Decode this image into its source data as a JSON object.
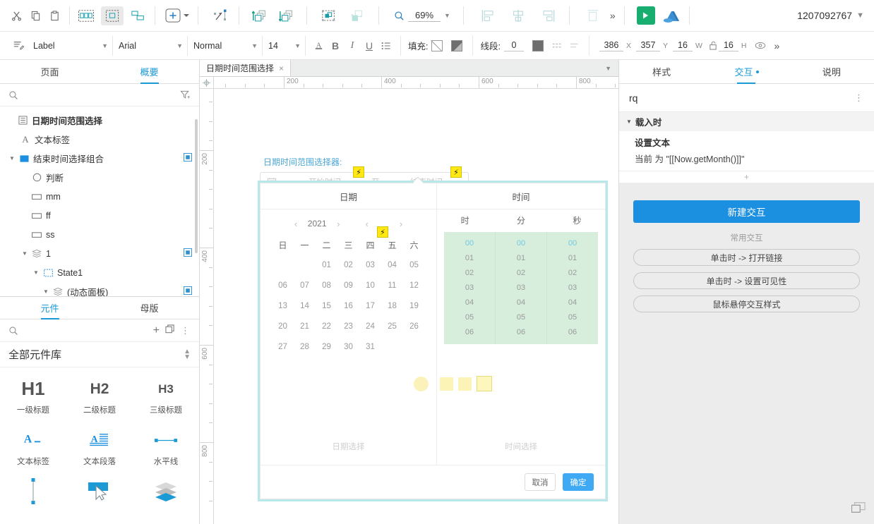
{
  "toolbar_top": {
    "icons": [
      "cut-icon",
      "copy-icon",
      "paste-icon"
    ],
    "group_icons": [
      "group-icon",
      "ungroup-icon",
      "layers-icon"
    ],
    "insert_label": "+",
    "align_icons": [
      "align-left-icon",
      "align-center-icon",
      "align-right-icon"
    ],
    "distribute_icon": "distribute-icon",
    "more_label": "»",
    "zoom_value": "69%",
    "user_id": "1207092767"
  },
  "toolbar_style": {
    "widget_type": "Label",
    "font_family": "Arial",
    "font_weight": "Normal",
    "font_size": "14",
    "fill_label": "填充:",
    "line_label": "线段:",
    "line_width": "0",
    "x_value": "386",
    "x_unit": "X",
    "y_value": "357",
    "y_unit": "Y",
    "w_value": "16",
    "w_unit": "W",
    "h_value": "16",
    "h_unit": "H",
    "format_icons": [
      "font-color-icon",
      "bold-icon",
      "italic-icon",
      "underline-icon",
      "list-icon"
    ],
    "more_label": "»"
  },
  "left_panel": {
    "tabs": [
      {
        "label": "页面",
        "selected": false
      },
      {
        "label": "概要",
        "selected": true
      }
    ],
    "search_placeholder": "",
    "filter_icon": "filter-icon",
    "tree": [
      {
        "label": "日期时间范围选择",
        "indent": 0,
        "icon": "page-icon",
        "arrow": "",
        "bold": true,
        "badge": false
      },
      {
        "label": "文本标签",
        "indent": 1,
        "icon": "text-label-icon",
        "arrow": "",
        "bold": false,
        "badge": false
      },
      {
        "label": "结束时间选择组合",
        "indent": 1,
        "icon": "group-folder-icon",
        "arrow": "▼",
        "bold": false,
        "badge": true
      },
      {
        "label": "判断",
        "indent": 2,
        "icon": "ellipse-icon",
        "arrow": "",
        "bold": false,
        "badge": false
      },
      {
        "label": "mm",
        "indent": 2,
        "icon": "rectangle-icon",
        "arrow": "",
        "bold": false,
        "badge": false
      },
      {
        "label": "ff",
        "indent": 2,
        "icon": "rectangle-icon",
        "arrow": "",
        "bold": false,
        "badge": false
      },
      {
        "label": "ss",
        "indent": 2,
        "icon": "rectangle-icon",
        "arrow": "",
        "bold": false,
        "badge": false
      },
      {
        "label": "1",
        "indent": 2,
        "icon": "dynamic-panel-icon",
        "arrow": "▼",
        "bold": false,
        "badge": true
      },
      {
        "label": "State1",
        "indent": 3,
        "icon": "state-icon",
        "arrow": "▼",
        "bold": false,
        "badge": false
      },
      {
        "label": "(动态面板)",
        "indent": 4,
        "icon": "dynamic-panel-icon",
        "arrow": "▼",
        "bold": false,
        "badge": true
      }
    ],
    "lib_tabs": [
      {
        "label": "元件",
        "selected": true
      },
      {
        "label": "母版",
        "selected": false
      }
    ],
    "lib_add_icon": "plus-icon",
    "lib_copy_icon": "duplicate-icon",
    "lib_more_icon": "kebab-icon",
    "lib_title": "全部元件库",
    "lib_items": [
      {
        "glyph": "H1",
        "label": "一级标题",
        "kind": "h1"
      },
      {
        "glyph": "H2",
        "label": "二级标题",
        "kind": "h2"
      },
      {
        "glyph": "H3",
        "label": "三级标题",
        "kind": "h3"
      },
      {
        "glyph": "A",
        "label": "文本标签",
        "kind": "text-label"
      },
      {
        "glyph": "A",
        "label": "文本段落",
        "kind": "text-paragraph"
      },
      {
        "glyph": "",
        "label": "水平线",
        "kind": "hline"
      },
      {
        "glyph": "",
        "label": "",
        "kind": "vline"
      },
      {
        "glyph": "",
        "label": "",
        "kind": "button"
      },
      {
        "glyph": "",
        "label": "",
        "kind": "panel"
      }
    ]
  },
  "canvas": {
    "page_tab": "日期时间范围选择",
    "page_tab_close": "×",
    "ruler_h_labels": [
      "200",
      "400",
      "600",
      "800"
    ],
    "ruler_v_labels": [
      "200",
      "400",
      "600",
      "800"
    ],
    "widget": {
      "title": "日期时间范围选择器:",
      "calendar_icon": "calendar-icon",
      "start_placeholder": "开始时间",
      "range_sep": "至",
      "end_placeholder": "结束时间",
      "bolt_glyph": "⚡",
      "date_col_header": "日期",
      "time_col_header": "时间",
      "year_value": "2021",
      "month_value": "",
      "prev_arrow": "‹",
      "next_arrow": "›",
      "dow": [
        "日",
        "一",
        "二",
        "三",
        "四",
        "五",
        "六"
      ],
      "leading_blanks": 2,
      "days": [
        "01",
        "02",
        "03",
        "04",
        "05",
        "06",
        "07",
        "08",
        "09",
        "10",
        "11",
        "12",
        "13",
        "14",
        "15",
        "16",
        "17",
        "18",
        "19",
        "20",
        "21",
        "22",
        "23",
        "24",
        "25",
        "26",
        "27",
        "28",
        "29",
        "30",
        "31"
      ],
      "time_headers": [
        "时",
        "分",
        "秒"
      ],
      "time_values": [
        "00",
        "01",
        "02",
        "03",
        "04",
        "05",
        "06"
      ],
      "date_footer": "日期选择",
      "time_footer": "时间选择",
      "cancel_label": "取消",
      "ok_label": "确定"
    }
  },
  "right_panel": {
    "tabs": [
      {
        "label": "样式",
        "selected": false,
        "dot": false
      },
      {
        "label": "交互",
        "selected": true,
        "dot": true
      },
      {
        "label": "说明",
        "selected": false,
        "dot": false
      }
    ],
    "widget_name": "rq",
    "kebab_icon": "kebab-icon",
    "event_header": "载入时",
    "event_arrow": "▼",
    "action_name": "设置文本",
    "action_detail": "当前 为 \"[[Now.getMonth()]]\"",
    "add_action": "+",
    "new_interaction": "新建交互",
    "common_label": "常用交互",
    "common_items": [
      "单击时 -> 打开链接",
      "单击时 -> 设置可见性",
      "鼠标悬停交互样式"
    ],
    "corner_icon": "resize-icon"
  },
  "colors": {
    "accent": "#1b9ad6",
    "primary_button": "#1b8fe0",
    "ok_button": "#40a9f3",
    "play_green": "#18ae70",
    "time_band": "#d7eedd",
    "bolt_yellow": "#ffe814",
    "selection_border": "#b9e8ea"
  }
}
